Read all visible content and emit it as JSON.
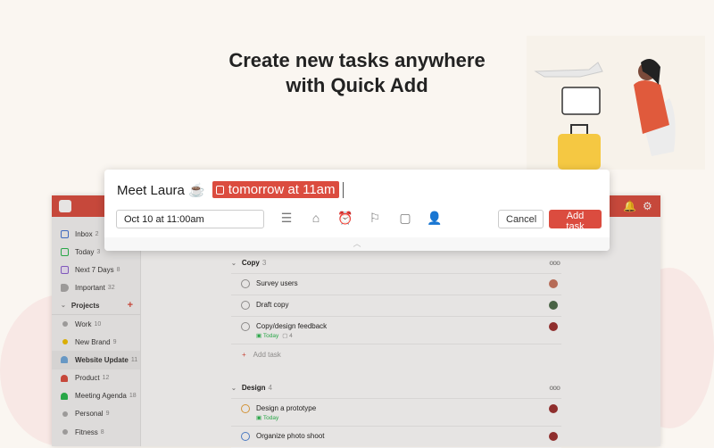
{
  "headline": {
    "line1": "Create new tasks anywhere",
    "line2": "with Quick Add"
  },
  "quick_add": {
    "task_text": "Meet Laura ☕",
    "date_chip": "tomorrow at 11am",
    "date_value": "Oct 10 at 11:00am",
    "cancel_label": "Cancel",
    "add_label": "Add task",
    "expand_glyph": "︿"
  },
  "sidebar": {
    "items": [
      {
        "label": "Inbox",
        "count": "2"
      },
      {
        "label": "Today",
        "count": "3"
      },
      {
        "label": "Next 7 Days",
        "count": "8"
      },
      {
        "label": "Important",
        "count": "32"
      }
    ],
    "projects_label": "Projects",
    "projects_add": "+",
    "projects": [
      {
        "label": "Work",
        "count": "10"
      },
      {
        "label": "New Brand",
        "count": "9"
      },
      {
        "label": "Website Update",
        "count": "11"
      },
      {
        "label": "Product",
        "count": "12"
      },
      {
        "label": "Meeting Agenda",
        "count": "18"
      },
      {
        "label": "Personal",
        "count": "9"
      },
      {
        "label": "Fitness",
        "count": "8"
      }
    ]
  },
  "sections": [
    {
      "name": "Copy",
      "count": "3",
      "tasks": [
        {
          "title": "Survey users"
        },
        {
          "title": "Draft copy"
        },
        {
          "title": "Copy/design feedback",
          "due": "Today",
          "comments": "4"
        }
      ],
      "add_task": "Add task"
    },
    {
      "name": "Design",
      "count": "4",
      "tasks": [
        {
          "title": "Design a prototype",
          "due": "Today"
        },
        {
          "title": "Organize photo shoot"
        }
      ]
    }
  ],
  "colors": {
    "brand": "#db4c3f",
    "today": "#25b84c"
  }
}
